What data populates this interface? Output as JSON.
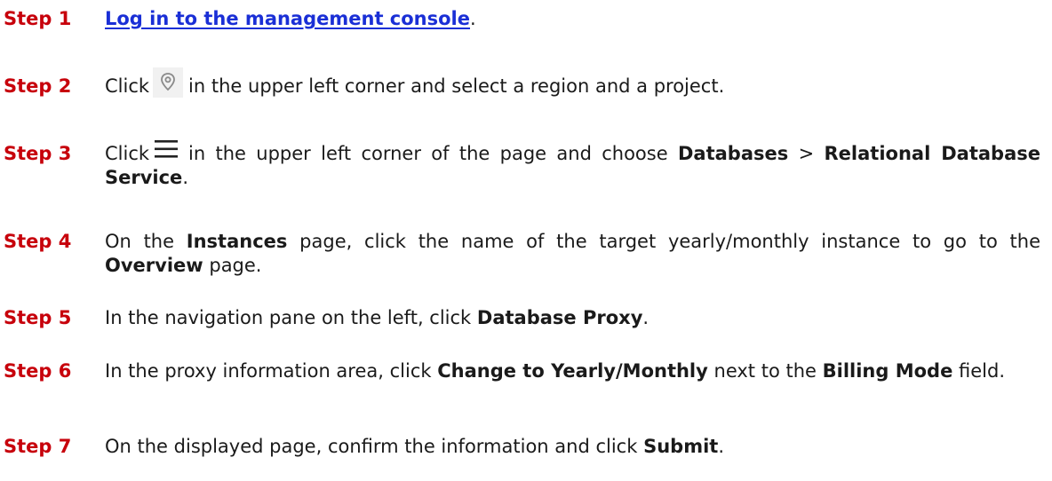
{
  "steps": [
    {
      "label": "Step 1",
      "link": "Log in to the management console",
      "tail": "."
    },
    {
      "label": "Step 2",
      "pre": "Click",
      "icon": "location-pin-icon",
      "post": "in the upper left corner and select a region and a project."
    },
    {
      "label": "Step 3",
      "pre": "Click",
      "icon": "menu-icon",
      "mid": "in the upper left corner of the page and choose",
      "b1": "Databases",
      "sep": ">",
      "b2": "Relational Database Service",
      "tail": "."
    },
    {
      "label": "Step 4",
      "t1": "On the",
      "b1": "Instances",
      "t2": "page, click the name of the target yearly/monthly instance to go to the",
      "b2": "Overview",
      "t3": "page."
    },
    {
      "label": "Step 5",
      "t1": "In the navigation pane on the left, click",
      "b1": "Database Proxy",
      "tail": "."
    },
    {
      "label": "Step 6",
      "t1": "In the proxy information area, click",
      "b1": "Change to Yearly/Monthly",
      "t2": "next to the",
      "b2": "Billing Mode",
      "t3": "field."
    },
    {
      "label": "Step 7",
      "t1": "On the displayed page, confirm the information and click",
      "b1": "Submit",
      "tail": "."
    }
  ],
  "colors": {
    "step_label": "#c7000b",
    "link": "#1a2fd6",
    "text": "#1a1a1a",
    "icon_bg": "#f1f1f1"
  }
}
